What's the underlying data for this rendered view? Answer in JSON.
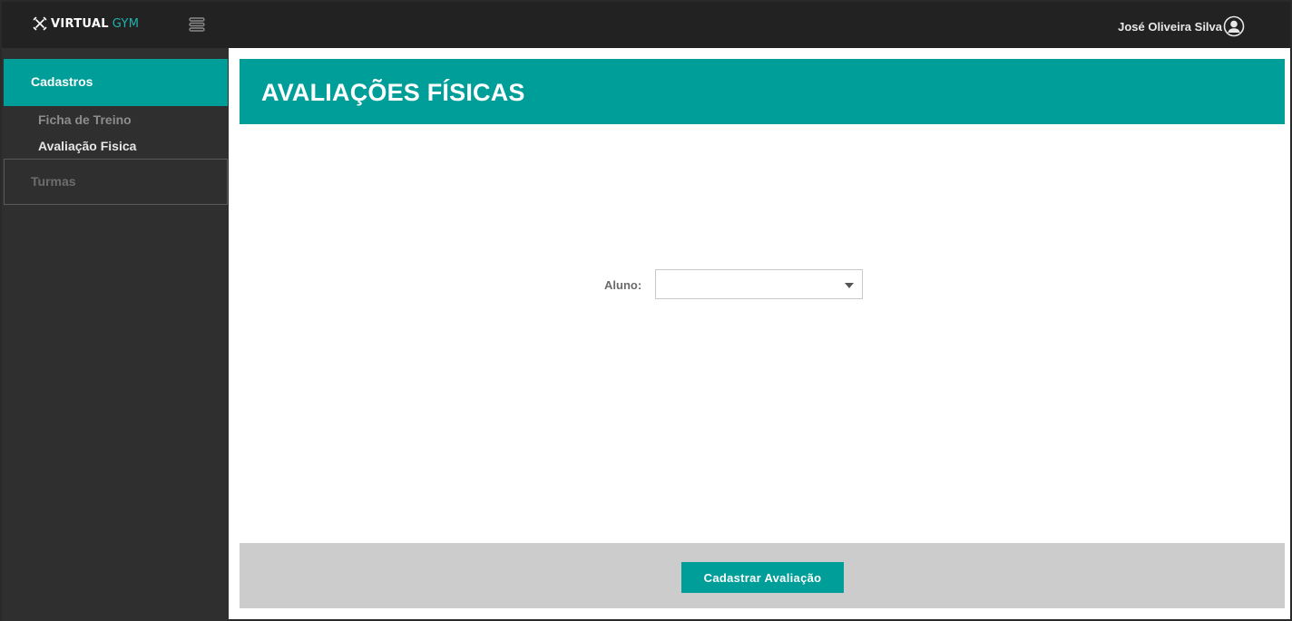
{
  "app": {
    "brand_primary": "VIRTUAL",
    "brand_accent": "GYM",
    "brand_icon": "dumbbell-cross-icon",
    "menu_icon": "hamburger-icon",
    "accent_color": "#009e99"
  },
  "user": {
    "name": "José Oliveira Silva",
    "avatar_icon": "user-circle-icon"
  },
  "sidebar": {
    "sections": [
      {
        "label": "Cadastros",
        "active": true,
        "items": [
          {
            "label": "Ficha de Treino",
            "active": false
          },
          {
            "label": "Avaliação Fisica",
            "active": true
          }
        ]
      },
      {
        "label": "Turmas",
        "active": false
      }
    ]
  },
  "main": {
    "title": "AVALIAÇÕES FÍSICAS",
    "form": {
      "aluno_label": "Aluno:",
      "aluno_value": "",
      "dropdown_icon": "caret-down-icon"
    },
    "submit_label": "Cadastrar Avaliação"
  }
}
